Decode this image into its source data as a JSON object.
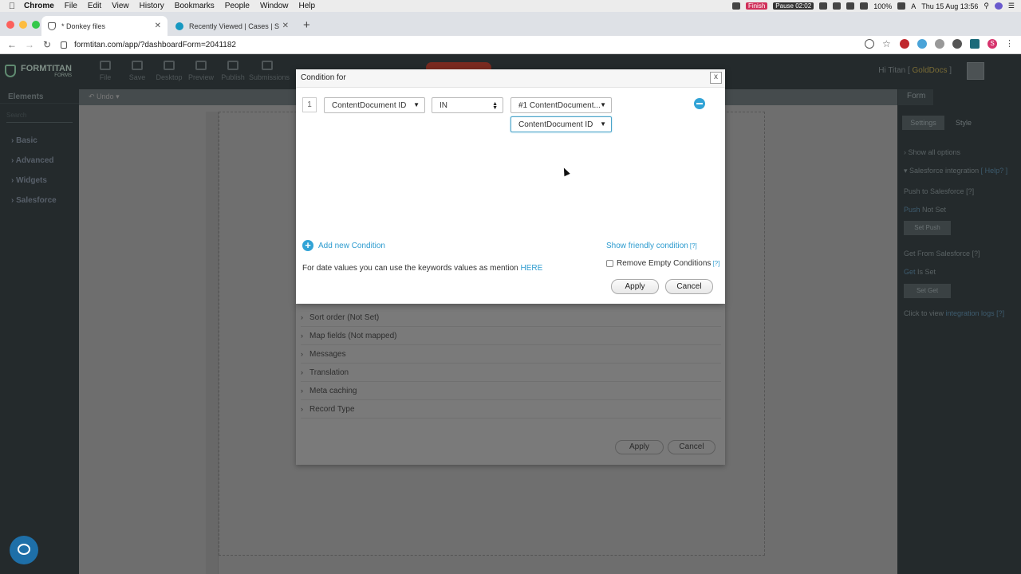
{
  "menubar": {
    "app": "Chrome",
    "items": [
      "File",
      "Edit",
      "View",
      "History",
      "Bookmarks",
      "People",
      "Window",
      "Help"
    ],
    "finish_badge": "Finish",
    "pause_badge": "Pause 02:02",
    "battery": "100%",
    "input_source": "A",
    "clock": "Thu 15 Aug  13:56"
  },
  "browser": {
    "tabs": [
      {
        "title": "* Donkey files",
        "active": true
      },
      {
        "title": "Recently Viewed | Cases | Sale",
        "active": false
      }
    ],
    "url": "formtitan.com/app/?dashboardForm=2041182",
    "profile_initial": "S"
  },
  "app": {
    "logo": "FORMTITAN",
    "logo_sub": "FORMS",
    "header_items": [
      "File",
      "Save",
      "Desktop",
      "Preview",
      "Publish",
      "Submissions"
    ],
    "greeting": "Hi Titan [",
    "account": "GoldDocs",
    "greeting_end": "]"
  },
  "left_panel": {
    "title": "Elements",
    "search_placeholder": "Search",
    "categories": [
      "Basic",
      "Advanced",
      "Widgets",
      "Salesforce"
    ]
  },
  "editor_toolbar": {
    "undo": "Undo"
  },
  "background_modal": {
    "sections": [
      "Sort order (Not Set)",
      "Map fields (Not mapped)",
      "Messages",
      "Translation",
      "Meta caching",
      "Record Type"
    ],
    "apply": "Apply",
    "cancel": "Cancel"
  },
  "right_panel": {
    "tab": "Form",
    "settings": "Settings",
    "style": "Style",
    "show_all": "Show all options",
    "sf_integration": "Salesforce integration",
    "help": "[ Help? ]",
    "push_to_sf": "Push to Salesforce",
    "push_label": "Push",
    "push_status": "Not Set",
    "set_push": "Set Push",
    "get_from_sf": "Get From Salesforce",
    "get_label": "Get",
    "get_status": "Is Set",
    "set_get": "Set Get",
    "logs_prefix": "Click to view",
    "logs_link": "integration logs",
    "q": "[?]"
  },
  "dialog": {
    "title": "Condition for",
    "close": "x",
    "row_number": "1",
    "field": "ContentDocument ID",
    "operator": "IN",
    "value_source": "#1 ContentDocument...",
    "value_field": "ContentDocument ID",
    "add_condition": "Add new Condition",
    "show_friendly": "Show friendly condition",
    "q": "[?]",
    "date_note": "For date values you can use the keywords values as mention",
    "here": "HERE",
    "remove_empty": "Remove Empty Conditions",
    "apply": "Apply",
    "cancel": "Cancel"
  }
}
